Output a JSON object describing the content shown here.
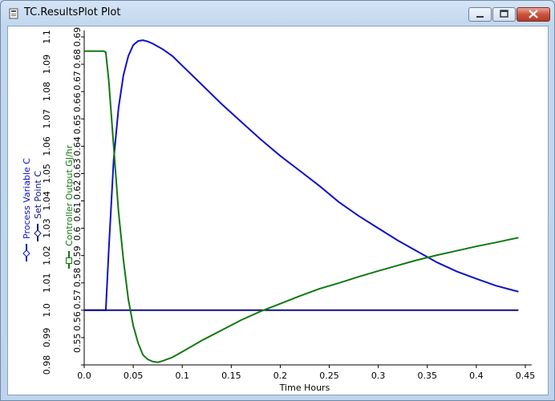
{
  "window": {
    "title": "TC.ResultsPlot Plot",
    "buttons": {
      "minimize": "minimize",
      "maximize": "maximize",
      "close": "close"
    }
  },
  "colors": {
    "blue": "#1010c8",
    "green": "#127812",
    "navy": "#101080"
  },
  "chart_data": {
    "type": "line",
    "xlabel": "Time Hours",
    "xlim": [
      0,
      0.45
    ],
    "x_ticks": [
      "0.0",
      "0.05",
      "0.1",
      "0.15",
      "0.2",
      "0.25",
      "0.3",
      "0.35",
      "0.4",
      "0.45"
    ],
    "left_axis": {
      "labels": [
        "Process Variable C",
        "Set Point C"
      ],
      "ylim": [
        0.98,
        1.1
      ],
      "ticks": [
        "0.98",
        "0.99",
        "1.0",
        "1.01",
        "1.02",
        "1.03",
        "1.04",
        "1.05",
        "1.06",
        "1.07",
        "1.08",
        "1.09",
        "1.1"
      ]
    },
    "right_axis": {
      "label": "Controller Output GJ/hr",
      "ylim": [
        0.54,
        0.69
      ],
      "ticks": [
        "0.55",
        "0.56",
        "0.57",
        "0.58",
        "0.59",
        "0.6",
        "0.61",
        "0.62",
        "0.63",
        "0.64",
        "0.65",
        "0.66",
        "0.67",
        "0.68",
        "0.69"
      ]
    },
    "series": [
      {
        "name": "Process Variable C",
        "axis": "left",
        "x": [
          0,
          0.02,
          0.022,
          0.025,
          0.03,
          0.035,
          0.04,
          0.045,
          0.05,
          0.055,
          0.06,
          0.065,
          0.07,
          0.08,
          0.09,
          0.1,
          0.12,
          0.14,
          0.16,
          0.18,
          0.2,
          0.22,
          0.24,
          0.26,
          0.28,
          0.3,
          0.32,
          0.34,
          0.36,
          0.38,
          0.4,
          0.42,
          0.443
        ],
        "y": [
          1.0,
          1.0,
          1.0,
          1.022,
          1.055,
          1.074,
          1.086,
          1.093,
          1.097,
          1.0985,
          1.0988,
          1.0983,
          1.0975,
          1.0955,
          1.093,
          1.0895,
          1.0825,
          1.0755,
          1.069,
          1.0625,
          1.0565,
          1.051,
          1.0455,
          1.0395,
          1.0345,
          1.03,
          1.0255,
          1.0215,
          1.0175,
          1.0142,
          1.0115,
          1.009,
          1.0068
        ]
      },
      {
        "name": "Set Point C",
        "axis": "left",
        "x": [
          0,
          0.443
        ],
        "y": [
          1.0,
          1.0
        ]
      },
      {
        "name": "Controller Output GJ/hr",
        "axis": "right",
        "x": [
          0,
          0.02,
          0.022,
          0.025,
          0.03,
          0.035,
          0.04,
          0.045,
          0.05,
          0.055,
          0.06,
          0.065,
          0.07,
          0.075,
          0.08,
          0.09,
          0.1,
          0.12,
          0.14,
          0.16,
          0.18,
          0.2,
          0.22,
          0.24,
          0.26,
          0.28,
          0.3,
          0.32,
          0.34,
          0.36,
          0.38,
          0.4,
          0.42,
          0.443
        ],
        "y": [
          0.6835,
          0.6835,
          0.683,
          0.67,
          0.64,
          0.61,
          0.588,
          0.57,
          0.558,
          0.55,
          0.5445,
          0.5425,
          0.5415,
          0.5412,
          0.5418,
          0.5435,
          0.546,
          0.5512,
          0.5558,
          0.5605,
          0.5645,
          0.568,
          0.5715,
          0.5748,
          0.5775,
          0.5803,
          0.583,
          0.5855,
          0.588,
          0.5902,
          0.5922,
          0.5942,
          0.596,
          0.5982
        ]
      }
    ]
  }
}
